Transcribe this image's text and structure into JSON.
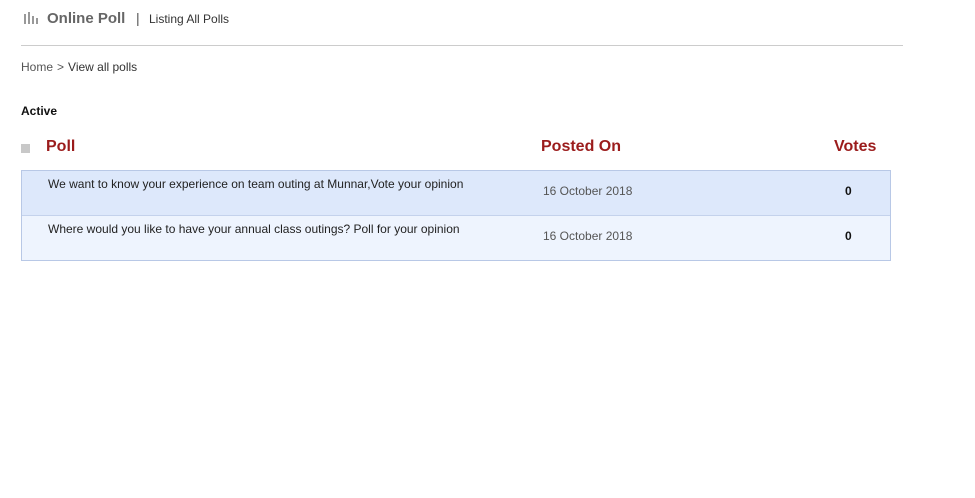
{
  "header": {
    "app_title": "Online Poll",
    "separator": "|",
    "subtitle": "Listing All Polls"
  },
  "breadcrumb": {
    "home": "Home",
    "separator": ">",
    "current": "View all polls"
  },
  "section": {
    "title": "Active"
  },
  "table": {
    "columns": {
      "poll": "Poll",
      "posted_on": "Posted On",
      "votes": "Votes"
    },
    "rows": [
      {
        "question": "We want to know your experience on team outing at Munnar,Vote your opinion",
        "posted_on": "16 October 2018",
        "votes": "0"
      },
      {
        "question": "Where would you like to have your annual class outings? Poll for your opinion",
        "posted_on": "16 October 2018",
        "votes": "0"
      }
    ]
  },
  "colors": {
    "header_text": "#9b1c1c",
    "row_odd": "#dde8fb",
    "row_even": "#eef4fe",
    "border": "#b8c8e6"
  },
  "icons": {
    "logo": "bar-chart-icon"
  }
}
